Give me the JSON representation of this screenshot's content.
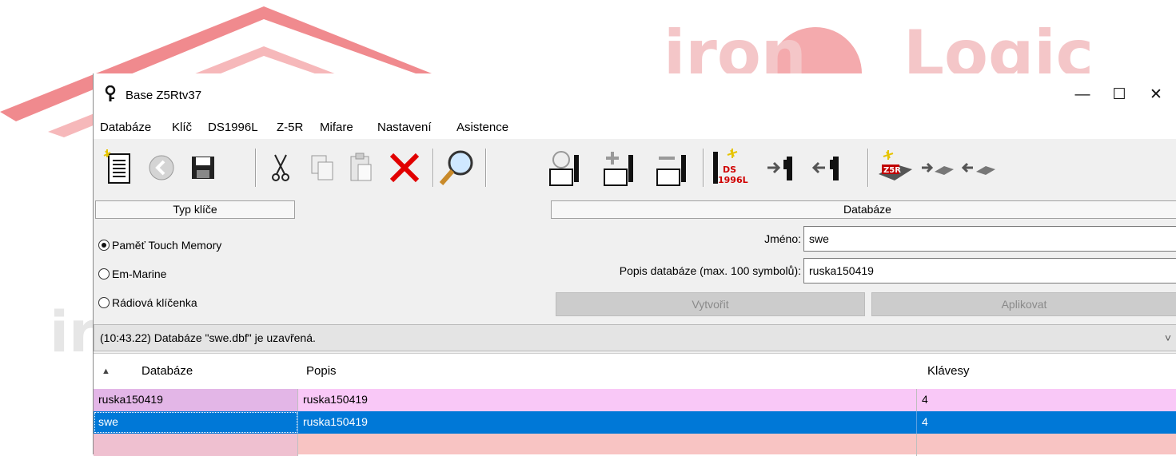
{
  "watermark": {
    "logo_text": "iron Logic",
    "left_text": "ir"
  },
  "window": {
    "title": "Base Z5Rtv37",
    "controls": {
      "minimize": "—",
      "maximize": "☐",
      "close": "✕"
    }
  },
  "menu": [
    "Databáze",
    "Klíč",
    "DS1996L",
    "Z-5R",
    "Mifare",
    "Nastavení",
    "Asistence"
  ],
  "toolbar_icons": [
    "new-document-icon",
    "back-icon",
    "save-icon",
    "cut-icon",
    "copy-icon",
    "paste-icon",
    "delete-icon",
    "search-icon",
    "find-key-icon",
    "add-key-icon",
    "remove-key-icon",
    "ds1996l-icon",
    "read-key-icon",
    "write-key-icon",
    "z5r-icon",
    "z5r-read-icon",
    "z5r-write-icon"
  ],
  "ds_label": "DS\n1996L",
  "z5r_label": "Z5R",
  "key_type": {
    "header": "Typ klíče",
    "options": [
      {
        "label": "Paměť Touch Memory",
        "selected": true
      },
      {
        "label": "Em-Marine",
        "selected": false
      },
      {
        "label": "Rádiová klíčenka",
        "selected": false
      }
    ]
  },
  "database": {
    "header": "Databáze",
    "name_label": "Jméno:",
    "name_value": "swe",
    "desc_label": "Popis databáze (max. 100 symbolů):",
    "desc_value": "ruska150419",
    "create_button": "Vytvořit",
    "apply_button": "Aplikovat"
  },
  "status": {
    "text": "(10:43.22) Databáze \"swe.dbf\" je uzavřená.",
    "chevron": "˅"
  },
  "table": {
    "sort_arrow": "▲",
    "columns": [
      "Databáze",
      "Popis",
      "Klávesy"
    ],
    "rows": [
      {
        "databaze": "ruska150419",
        "popis": "ruska150419",
        "klavesy": "4",
        "selected": false
      },
      {
        "databaze": "swe",
        "popis": "ruska150419",
        "klavesy": "4",
        "selected": true
      }
    ]
  },
  "colors": {
    "row_pink": "#f9c8f7",
    "row_pink_first_cell": "#e3b6e7",
    "row_selected": "#0078d7",
    "empty_rows": "#f8c4c3"
  }
}
